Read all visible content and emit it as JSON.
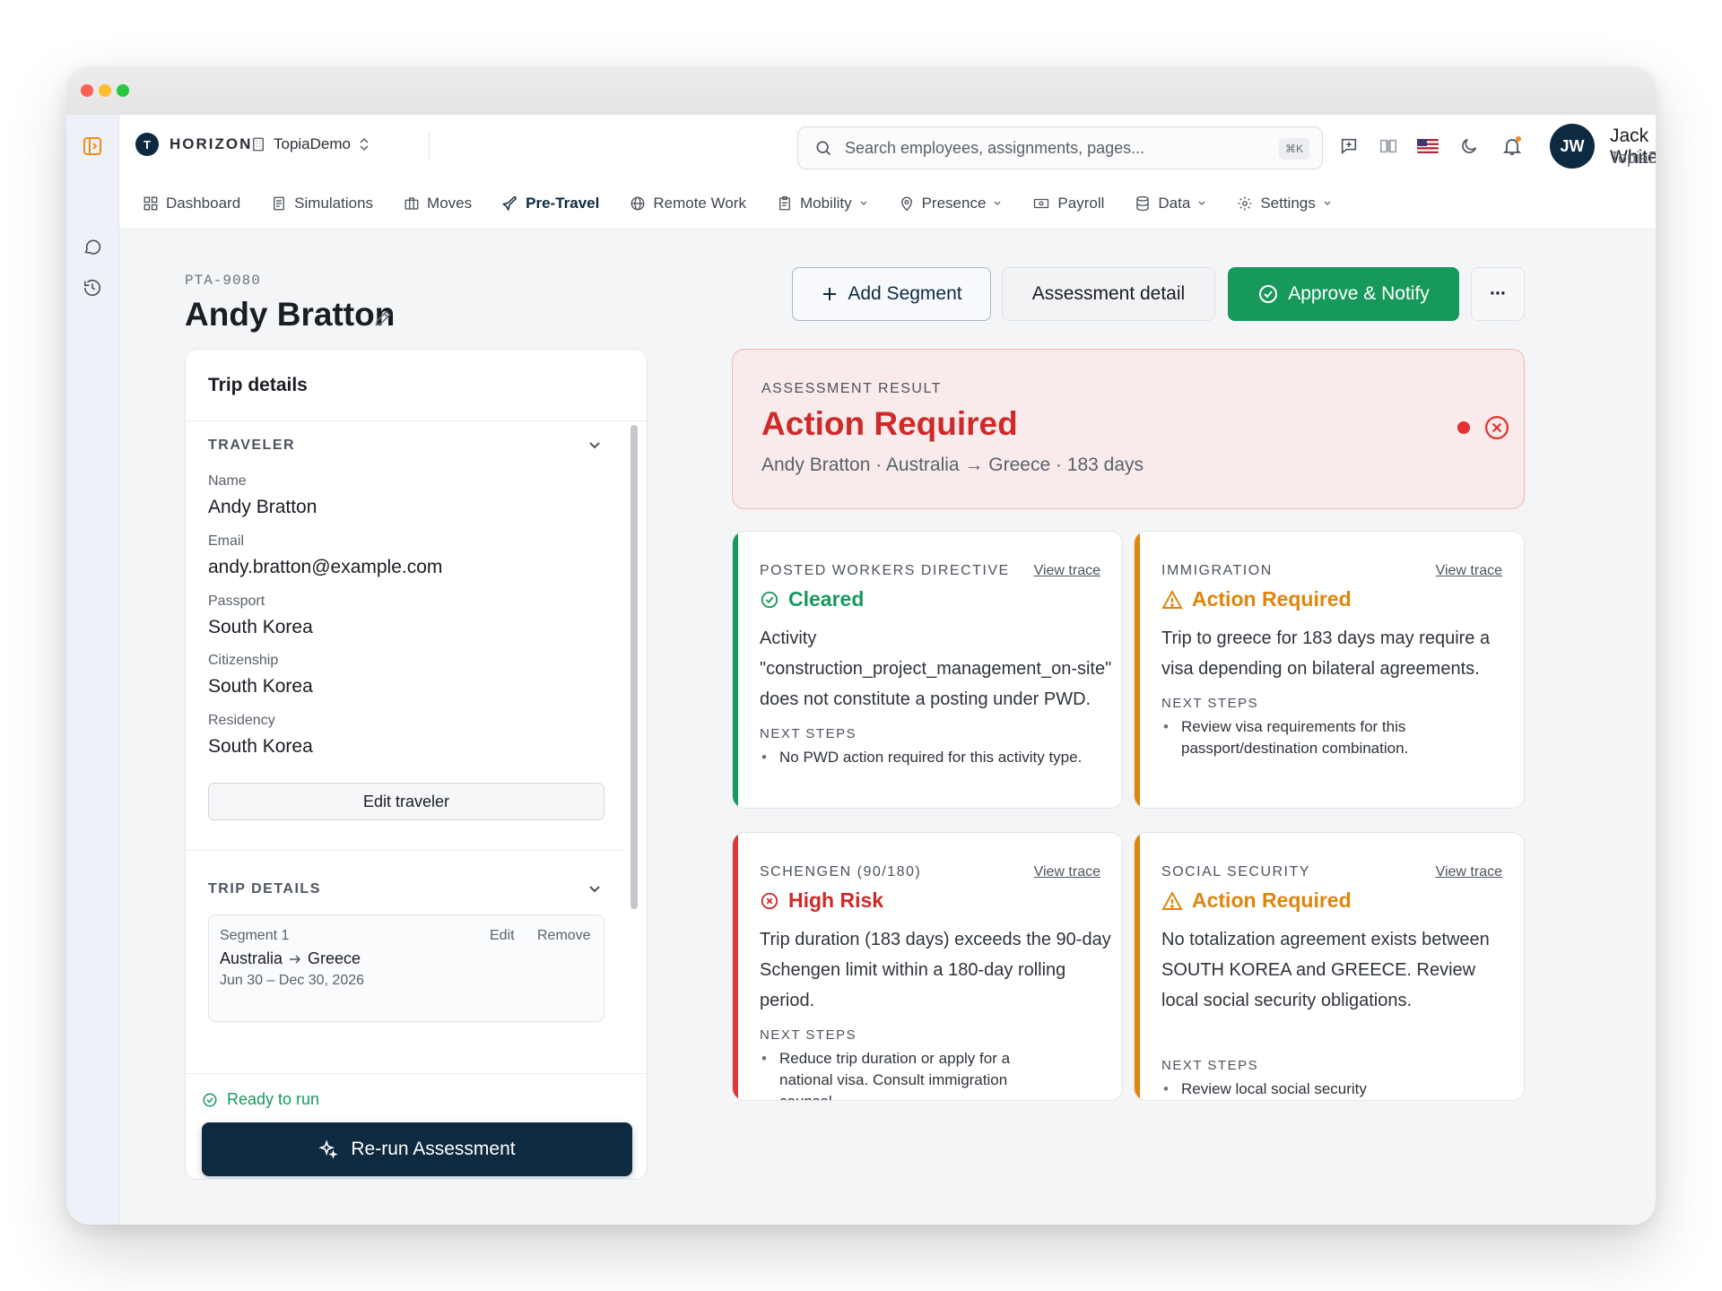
{
  "app": {
    "brand": "HORIZON",
    "brand_logo": "T",
    "org": "TopiaDemo"
  },
  "search": {
    "placeholder": "Search employees, assignments, pages...",
    "shortcut": "⌘K"
  },
  "user": {
    "initials": "JW",
    "name": "Jack White",
    "org": "TopiaDemo"
  },
  "nav": [
    {
      "label": "Dashboard",
      "icon": "dashboard-icon"
    },
    {
      "label": "Simulations",
      "icon": "document-icon"
    },
    {
      "label": "Moves",
      "icon": "briefcase-icon"
    },
    {
      "label": "Pre-Travel",
      "icon": "plane-icon",
      "active": true
    },
    {
      "label": "Remote Work",
      "icon": "globe-icon"
    },
    {
      "label": "Mobility",
      "icon": "clipboard-icon",
      "dropdown": true
    },
    {
      "label": "Presence",
      "icon": "pin-icon",
      "dropdown": true
    },
    {
      "label": "Payroll",
      "icon": "payroll-icon"
    },
    {
      "label": "Data",
      "icon": "database-icon",
      "dropdown": true
    },
    {
      "label": "Settings",
      "icon": "gear-icon",
      "dropdown": true
    }
  ],
  "page": {
    "id": "PTA-9080",
    "title": "Andy Bratton"
  },
  "actions": {
    "add_segment": "Add Segment",
    "assessment_detail": "Assessment detail",
    "approve_notify": "Approve & Notify",
    "more": "···"
  },
  "trip_panel": {
    "title": "Trip details",
    "traveler_heading": "TRAVELER",
    "fields": [
      {
        "label": "Name",
        "value": "Andy Bratton"
      },
      {
        "label": "Email",
        "value": "andy.bratton@example.com"
      },
      {
        "label": "Passport",
        "value": "South Korea"
      },
      {
        "label": "Citizenship",
        "value": "South Korea"
      },
      {
        "label": "Residency",
        "value": "South Korea"
      }
    ],
    "edit_traveler": "Edit traveler",
    "trip_heading": "TRIP DETAILS",
    "segment": {
      "label": "Segment 1",
      "edit": "Edit",
      "remove": "Remove",
      "origin": "Australia",
      "destination": "Greece",
      "dates": "Jun 30 – Dec 30, 2026"
    },
    "ready": "Ready to run",
    "rerun": "Re-run Assessment"
  },
  "result": {
    "kicker": "ASSESSMENT RESULT",
    "status": "Action Required",
    "summary": "Andy Bratton · Australia → Greece · 183 days",
    "color": "#cf2a2a"
  },
  "cards": [
    {
      "kicker": "POSTED WORKERS DIRECTIVE",
      "trace": "View trace",
      "status": "Cleared",
      "color": "#18995c",
      "description": "Activity \"construction_project_management_on-site\" does not constitute a posting under PWD.",
      "next_label": "NEXT STEPS",
      "steps": [
        "No PWD action required for this activity type."
      ]
    },
    {
      "kicker": "IMMIGRATION",
      "trace": "View trace",
      "status": "Action Required",
      "color": "#e0850b",
      "description": "Trip to greece for 183 days may require a visa depending on bilateral agreements.",
      "next_label": "NEXT STEPS",
      "steps": [
        "Review visa requirements for this passport/destination combination."
      ]
    },
    {
      "kicker": "SCHENGEN (90/180)",
      "trace": "View trace",
      "status": "High Risk",
      "color": "#cf2a2a",
      "description": "Trip duration (183 days) exceeds the 90-day Schengen limit within a 180-day rolling period.",
      "next_label": "NEXT STEPS",
      "steps": [
        "Reduce trip duration or apply for a national visa. Consult immigration counsel."
      ]
    },
    {
      "kicker": "SOCIAL SECURITY",
      "trace": "View trace",
      "status": "Action Required",
      "color": "#e0850b",
      "description": "No totalization agreement exists between SOUTH KOREA and GREECE. Review local social security obligations.",
      "next_label": "NEXT STEPS",
      "steps": [
        "Review local social security requirements. Consider whether voluntary coverage applies."
      ]
    }
  ]
}
